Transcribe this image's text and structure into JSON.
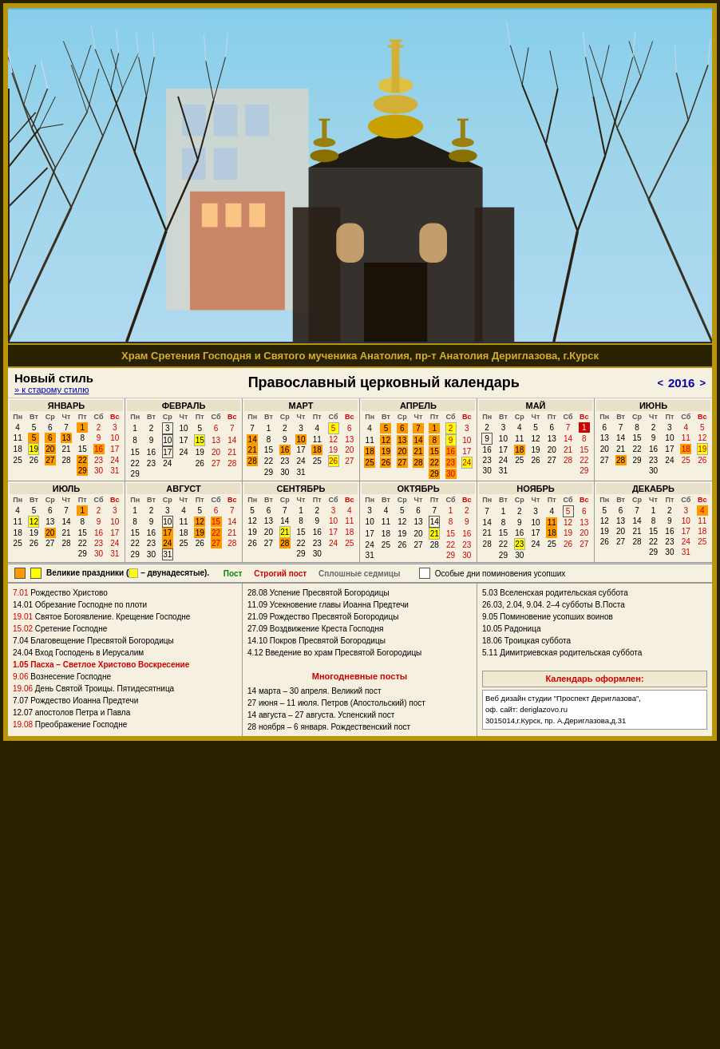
{
  "photo": {
    "caption": "Храм Сретения Господня и Святого мученика Анатолия, пр-т Анатолия Дериглазова,  г.Курск"
  },
  "header": {
    "new_style": "Новый стиль",
    "old_style_link": "» к старому стилю",
    "main_title": "Православный церковный календарь",
    "year": "2016",
    "nav_prev": "<",
    "nav_next": ">"
  },
  "months": [
    {
      "name": "ЯНВАРЬ",
      "abbr": "Пн"
    },
    {
      "name": "ФЕВРАЛЬ"
    },
    {
      "name": "МАРТ"
    },
    {
      "name": "АПРЕЛЬ"
    },
    {
      "name": "МАЙ"
    },
    {
      "name": "ИЮНЬ"
    },
    {
      "name": "ИЮЛЬ"
    },
    {
      "name": "АВГУСТ"
    },
    {
      "name": "СЕНТЯБРЬ"
    },
    {
      "name": "ОКТЯБРЬ"
    },
    {
      "name": "НОЯБРЬ"
    },
    {
      "name": "ДЕКАБРЬ"
    }
  ],
  "legend": {
    "great_label": "Великие праздники (",
    "twelve_label": "– двунадесятые).",
    "fast_label": "Пост",
    "strict_label": "Строгий пост",
    "continuous_label": "Сплошные седмицы",
    "memorial_label": "Особые дни поминовения усопших"
  },
  "holidays_col1": [
    {
      "date": "7.01",
      "text": "Рождество Христово",
      "style": "red"
    },
    {
      "date": "14.01",
      "text": "Обрезание Господне по плоти",
      "style": "normal"
    },
    {
      "date": "19.01",
      "text": "Святое Богоявление. Крещение Господне",
      "style": "red"
    },
    {
      "date": "15.02",
      "text": "Сретение Господне",
      "style": "red"
    },
    {
      "date": "7.04",
      "text": "Благовещение Пресвятой Богородицы",
      "style": "red"
    },
    {
      "date": "24.04",
      "text": "Вход Господень в Иерусалим",
      "style": "normal"
    },
    {
      "date": "1.05",
      "text": "Пасха – Светлое Христово Воскресение",
      "style": "red bold"
    },
    {
      "date": "9.06",
      "text": "Вознесение Господне",
      "style": "red"
    },
    {
      "date": "19.06",
      "text": "День Святой Троицы. Пятидесятница",
      "style": "red"
    },
    {
      "date": "7.07",
      "text": "Рождество Иоанна Предтечи",
      "style": "normal"
    },
    {
      "date": "12.07",
      "text": "апостолов Петра и Павла",
      "style": "normal"
    },
    {
      "date": "19.08",
      "text": "Преображение Господне",
      "style": "red"
    }
  ],
  "holidays_col2": [
    {
      "date": "28.08",
      "text": "Успение Пресвятой Богородицы",
      "style": "red"
    },
    {
      "date": "11.09",
      "text": "Усекновение главы Иоанна Предтечи",
      "style": "normal"
    },
    {
      "date": "21.09",
      "text": "Рождество Пресвятой Богородицы",
      "style": "red"
    },
    {
      "date": "27.09",
      "text": "Воздвижение Креста Господня",
      "style": "red"
    },
    {
      "date": "14.10",
      "text": "Покров Пресвятой Богородицы",
      "style": "normal"
    },
    {
      "date": "4.12",
      "text": "Введение во храм Пресвятой Богородицы",
      "style": "red"
    }
  ],
  "fasting_title": "Многодневные посты",
  "fasting_items": [
    "14 марта – 30 апреля. Великий пост",
    "27 июня – 11 июля. Петров (Апостольский) пост",
    "14 августа – 27 августа. Успенский пост",
    "28 ноября – 6 января. Рождественский пост"
  ],
  "holidays_col3": [
    {
      "date": "5.03",
      "text": "Вселенская родительская суббота"
    },
    {
      "date": "26.03, 2.04, 9.04.",
      "text": "2–4 субботы В.Поста"
    },
    {
      "date": "9.05",
      "text": "Поминовение усопших воинов"
    },
    {
      "date": "10.05",
      "text": "Радоница"
    },
    {
      "date": "18.06",
      "text": "Троицкая суббота"
    },
    {
      "date": "5.11",
      "text": "Димитриевская родительская суббота"
    }
  ],
  "card_title": "Календарь оформлен:",
  "card_text": "Веб дизайн студии \"Проспект Дериглазова\",\nоф. сайт: deriglazovo.ru\n3015014,г.Курск, пр. А.Дериглазова,д.31"
}
